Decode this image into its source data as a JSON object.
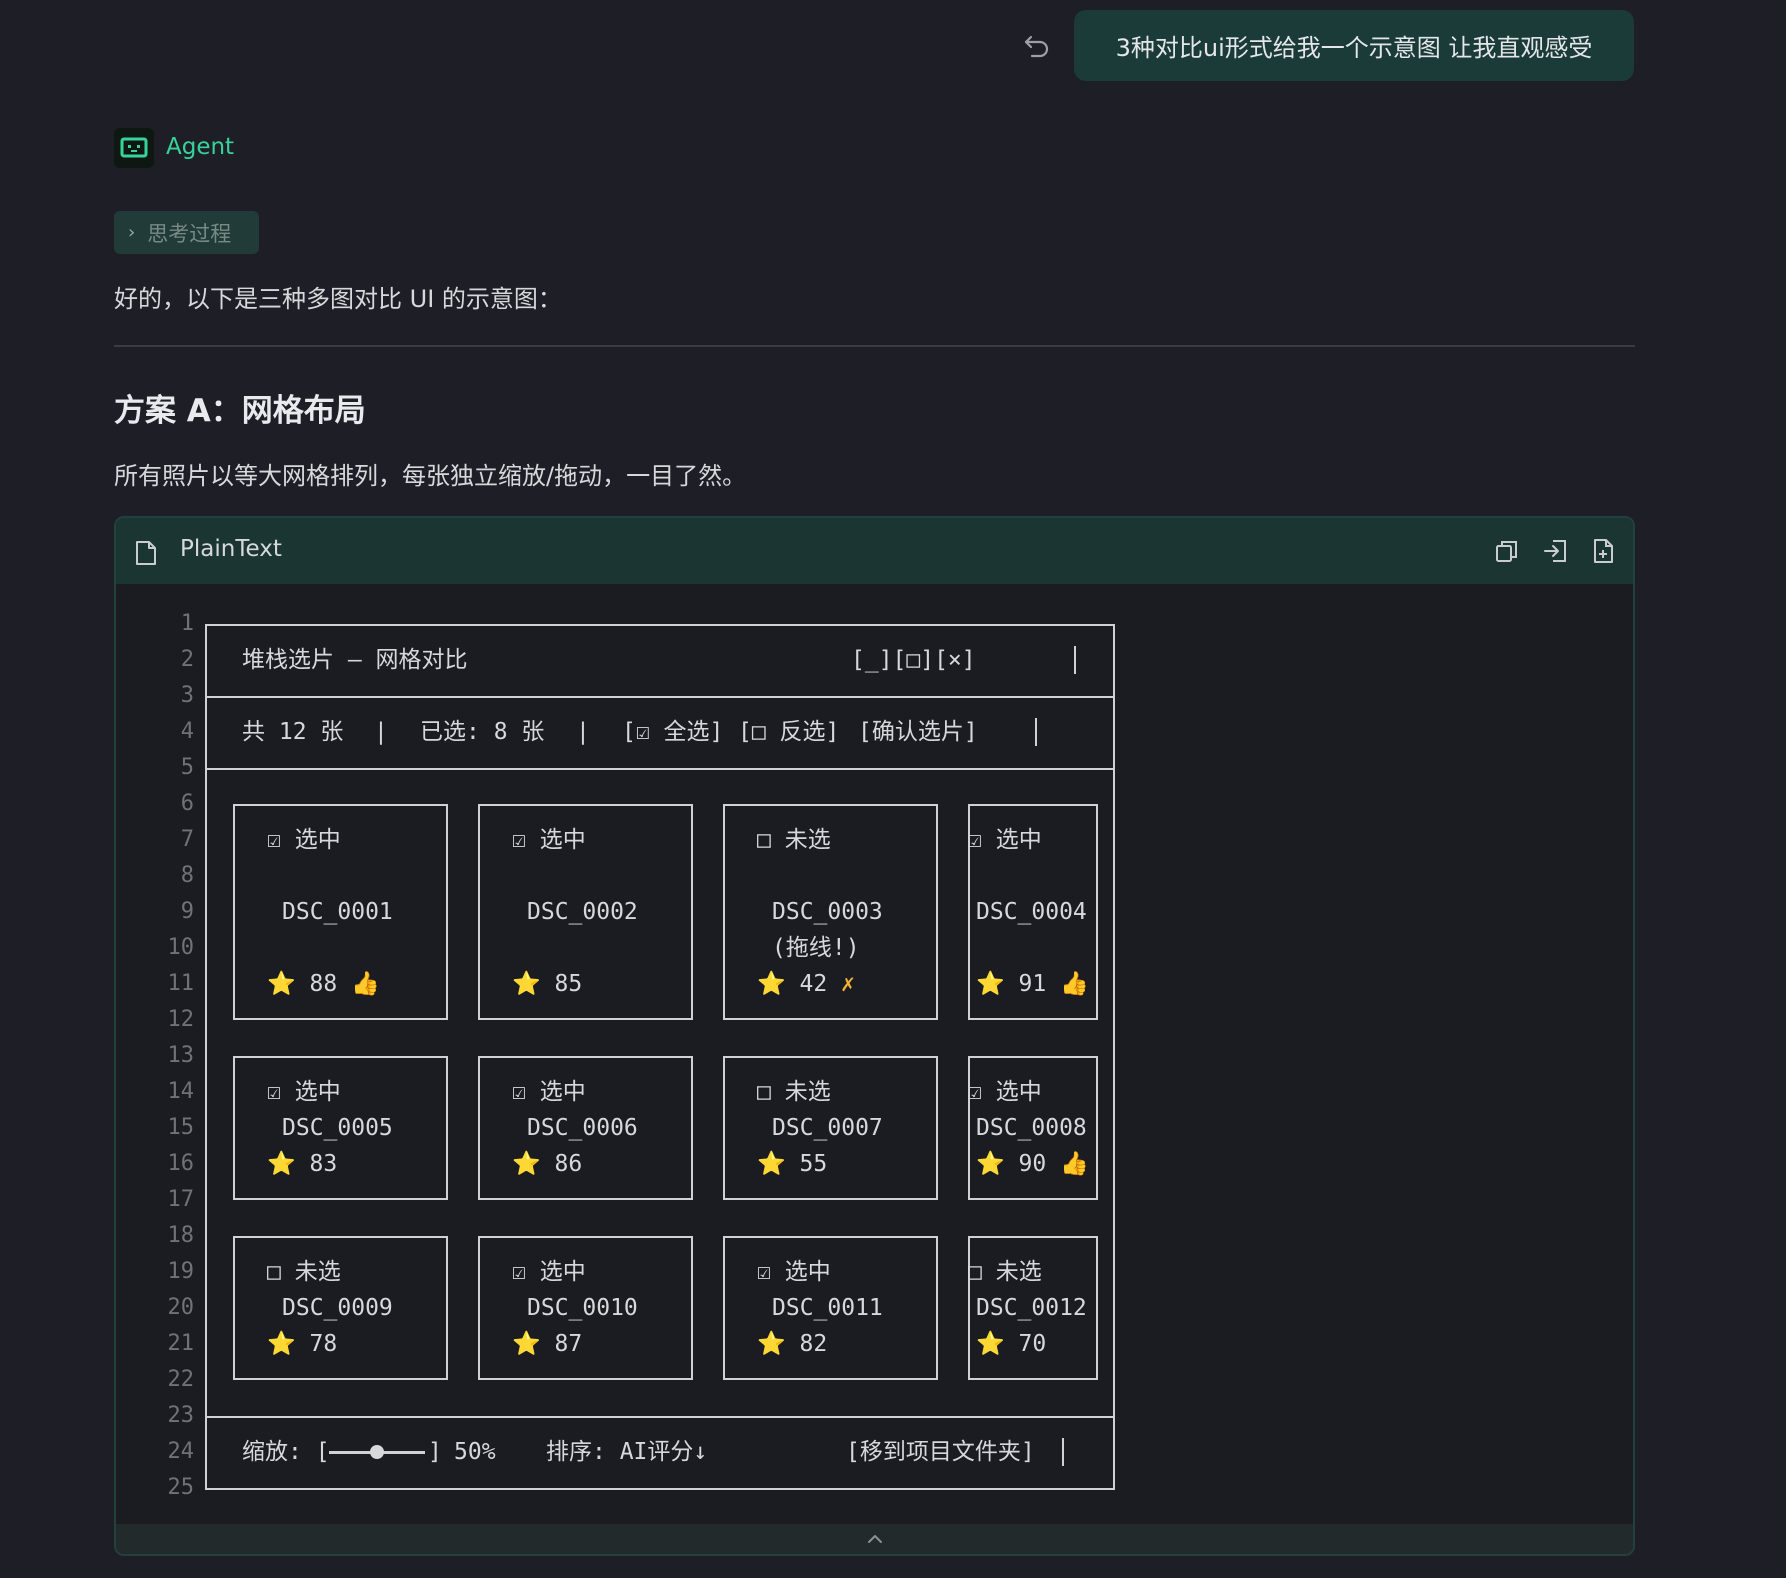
{
  "user_message": "3种对比ui形式给我一个示意图 让我直观感受",
  "agent": {
    "name": "Agent",
    "thinking_label": "思考过程",
    "intro": "好的，以下是三种多图对比 UI 的示意图：",
    "section_heading": "方案 A：网格布局",
    "section_desc": "所有照片以等大网格排列，每张独立缩放/拖动，一目了然。"
  },
  "code_block": {
    "language": "PlainText",
    "line_numbers": [
      "1",
      "2",
      "3",
      "4",
      "5",
      "6",
      "7",
      "8",
      "9",
      "10",
      "11",
      "12",
      "13",
      "14",
      "15",
      "16",
      "17",
      "18",
      "19",
      "20",
      "21",
      "22",
      "23",
      "24",
      "25"
    ],
    "window_title": "堆栈选片 — 网格对比",
    "window_controls": "[_][□][×]",
    "total": "共 12 张",
    "selected": "已选: 8 张",
    "select_all": "[☑ 全选]",
    "invert": "[□ 反选]",
    "confirm": "[确认选片]",
    "zoom_label": "缩放: [",
    "zoom_end": "]",
    "zoom_value": "50%",
    "sort_label": "排序: AI评分↓",
    "move_to": "[移到项目文件夹]",
    "cards": [
      {
        "status": "☑ 选中",
        "name": "DSC_0001",
        "star": "⭐",
        "score": "88",
        "badge": "👍"
      },
      {
        "status": "☑ 选中",
        "name": "DSC_0002",
        "star": "⭐",
        "score": "85",
        "badge": ""
      },
      {
        "status": "□ 未选",
        "name": "DSC_0003",
        "note": "(拖线!)",
        "star": "⭐",
        "score": "42",
        "badge": "✗"
      },
      {
        "status": "☑ 选中",
        "name": "DSC_0004",
        "star": "⭐",
        "score": "91",
        "badge": "👍"
      },
      {
        "status": "☑ 选中",
        "name": "DSC_0005",
        "star": "⭐",
        "score": "83",
        "badge": ""
      },
      {
        "status": "☑ 选中",
        "name": "DSC_0006",
        "star": "⭐",
        "score": "86",
        "badge": ""
      },
      {
        "status": "□ 未选",
        "name": "DSC_0007",
        "star": "⭐",
        "score": "55",
        "badge": ""
      },
      {
        "status": "☑ 选中",
        "name": "DSC_0008",
        "star": "⭐",
        "score": "90",
        "badge": "👍"
      },
      {
        "status": "□ 未选",
        "name": "DSC_0009",
        "star": "⭐",
        "score": "78",
        "badge": ""
      },
      {
        "status": "☑ 选中",
        "name": "DSC_0010",
        "star": "⭐",
        "score": "87",
        "badge": ""
      },
      {
        "status": "☑ 选中",
        "name": "DSC_0011",
        "star": "⭐",
        "score": "82",
        "badge": ""
      },
      {
        "status": "□ 未选",
        "name": "DSC_0012",
        "star": "⭐",
        "score": "70",
        "badge": ""
      }
    ]
  },
  "zoom_slider_level": 0.5,
  "colors": {
    "accent": "#36d39a",
    "bubble": "#1a3b37",
    "code_header": "#1b3533",
    "star": "#f4c21d"
  }
}
